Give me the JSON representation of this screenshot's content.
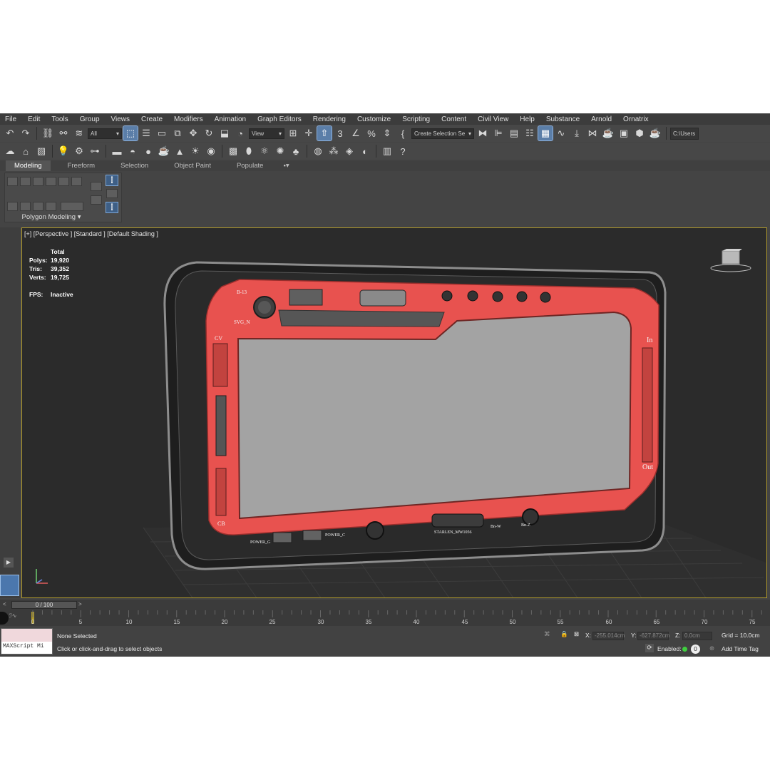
{
  "menu": [
    "File",
    "Edit",
    "Tools",
    "Group",
    "Views",
    "Create",
    "Modifiers",
    "Animation",
    "Graph Editors",
    "Rendering",
    "Customize",
    "Scripting",
    "Content",
    "Civil View",
    "Help",
    "Substance",
    "Arnold",
    "Ornatrix"
  ],
  "toolbar": {
    "filter_select": "All",
    "ref_coord_select": "View",
    "named_selection": "Create Selection Se",
    "path": "C:\\Users"
  },
  "ribbon": {
    "tabs": [
      "Modeling",
      "Freeform",
      "Selection",
      "Object Paint",
      "Populate"
    ],
    "panel_label": "Polygon Modeling"
  },
  "viewport": {
    "label": "[+] [Perspective ] [Standard ] [Default Shading ]",
    "stats": {
      "header": "Total",
      "polys_label": "Polys:",
      "polys": "19,920",
      "tris_label": "Tris:",
      "tris": "39,352",
      "verts_label": "Verts:",
      "verts": "19,725",
      "fps_label": "FPS:",
      "fps": "Inactive"
    },
    "model_labels": {
      "b13": "B-13",
      "svgn": "SVG_N",
      "cv": "CV",
      "cb": "CB",
      "in": "In",
      "out": "Out",
      "power_g": "POWER_G",
      "power_c": "POWER_C",
      "starlen": "STARLEN_MW1056",
      "bnw": "Bn-W",
      "bnz": "Bn-Z"
    }
  },
  "timeline": {
    "frame": "0 / 100",
    "ticks": [
      "0",
      "5",
      "10",
      "15",
      "20",
      "25",
      "30",
      "35",
      "40",
      "45",
      "50",
      "55",
      "60",
      "65",
      "70",
      "75"
    ]
  },
  "status": {
    "maxscript": "MAXScript Mi",
    "selection": "None Selected",
    "prompt": "Click or click-and-drag to select objects",
    "x_label": "X:",
    "x": "-255.014cm",
    "y_label": "Y:",
    "y": "-627.872cm",
    "z_label": "Z:",
    "z": "0.0cm",
    "grid": "Grid = 10.0cm",
    "enabled_label": "Enabled:",
    "add_time_tag": "Add Time Tag"
  },
  "colors": {
    "accent": "#5b7ea8",
    "viewport_border": "#b09a2c",
    "frame_red": "#e8524f"
  }
}
